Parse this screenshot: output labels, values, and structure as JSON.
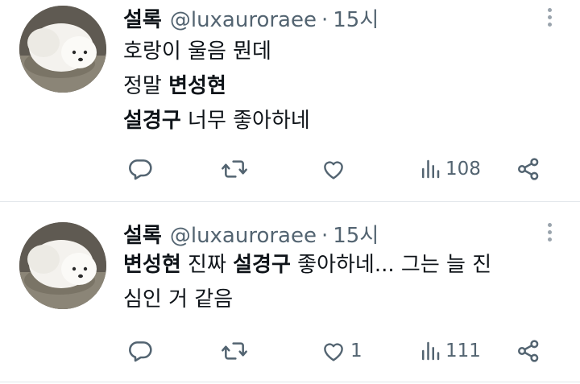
{
  "tweets": [
    {
      "name": "설록",
      "handle": "@luxauroraee",
      "separator": "·",
      "time": "15시",
      "lines": [
        [
          {
            "text": "호랑이 울음 뭔데",
            "bold": false
          }
        ],
        [
          {
            "text": "정말 ",
            "bold": false
          },
          {
            "text": "변성현",
            "bold": true
          }
        ],
        [
          {
            "text": "설경구",
            "bold": true
          },
          {
            "text": " 너무 좋아하네",
            "bold": false
          }
        ]
      ],
      "likes": "",
      "views": "108",
      "icons": {
        "reply": "reply-icon",
        "retweet": "retweet-icon",
        "like": "heart-icon",
        "views": "views-icon",
        "share": "share-icon",
        "more": "more-icon"
      }
    },
    {
      "name": "설록",
      "handle": "@luxauroraee",
      "separator": "·",
      "time": "15시",
      "lines": [
        [
          {
            "text": "변성현",
            "bold": true
          },
          {
            "text": " 진짜 ",
            "bold": false
          },
          {
            "text": "설경구",
            "bold": true
          },
          {
            "text": " 좋아하네... 그는 늘 진",
            "bold": false
          }
        ],
        [
          {
            "text": "심인 거 같음",
            "bold": false
          }
        ]
      ],
      "likes": "1",
      "views": "111",
      "icons": {
        "reply": "reply-icon",
        "retweet": "retweet-icon",
        "like": "heart-icon",
        "views": "views-icon",
        "share": "share-icon",
        "more": "more-icon"
      }
    }
  ],
  "colors": {
    "text": "#0f1419",
    "secondary": "#536471",
    "divider": "#e1e6ea"
  }
}
